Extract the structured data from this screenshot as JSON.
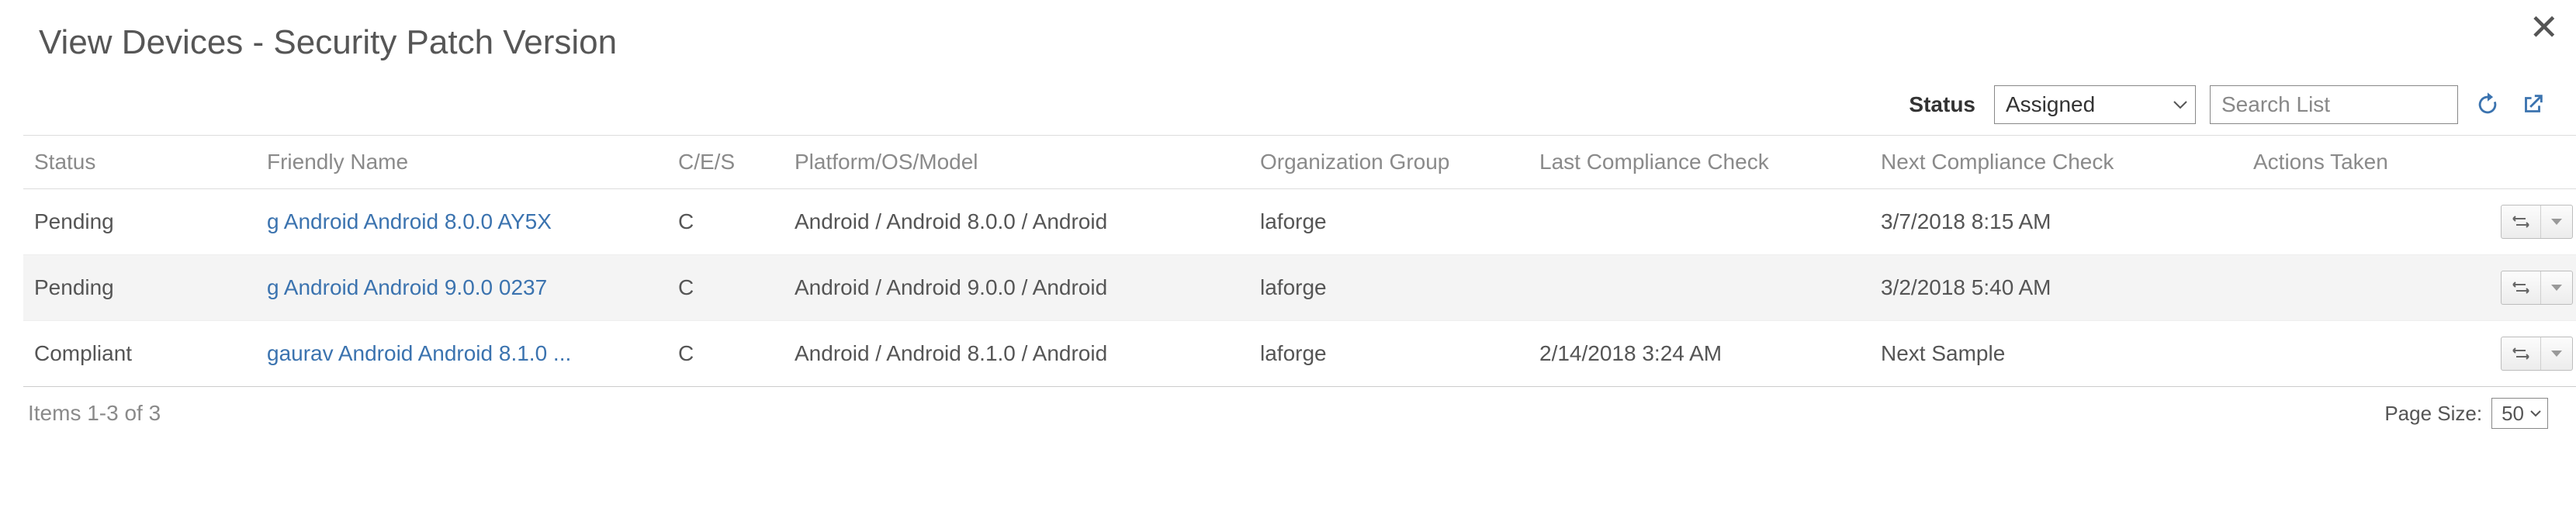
{
  "title": "View Devices - Security Patch Version",
  "toolbar": {
    "status_label": "Status",
    "status_value": "Assigned",
    "search_placeholder": "Search List"
  },
  "columns": {
    "status": "Status",
    "friendly_name": "Friendly Name",
    "ces": "C/E/S",
    "platform": "Platform/OS/Model",
    "org_group": "Organization Group",
    "last_check": "Last Compliance Check",
    "next_check": "Next Compliance Check",
    "actions": "Actions Taken"
  },
  "rows": [
    {
      "status": "Pending",
      "friendly_name": "g Android Android 8.0.0 AY5X",
      "ces": "C",
      "platform": "Android / Android 8.0.0 / Android",
      "org_group": "laforge",
      "last_check": "",
      "next_check": "3/7/2018 8:15 AM",
      "actions": ""
    },
    {
      "status": "Pending",
      "friendly_name": "g Android Android 9.0.0 0237",
      "ces": "C",
      "platform": "Android / Android 9.0.0 / Android",
      "org_group": "laforge",
      "last_check": "",
      "next_check": "3/2/2018 5:40 AM",
      "actions": ""
    },
    {
      "status": "Compliant",
      "friendly_name": "gaurav Android Android 8.1.0 ...",
      "ces": "C",
      "platform": "Android / Android 8.1.0 / Android",
      "org_group": "laforge",
      "last_check": "2/14/2018 3:24 AM",
      "next_check": "Next Sample",
      "actions": ""
    }
  ],
  "footer": {
    "summary": "Items 1-3 of 3",
    "page_size_label": "Page Size:",
    "page_size_value": "50"
  }
}
